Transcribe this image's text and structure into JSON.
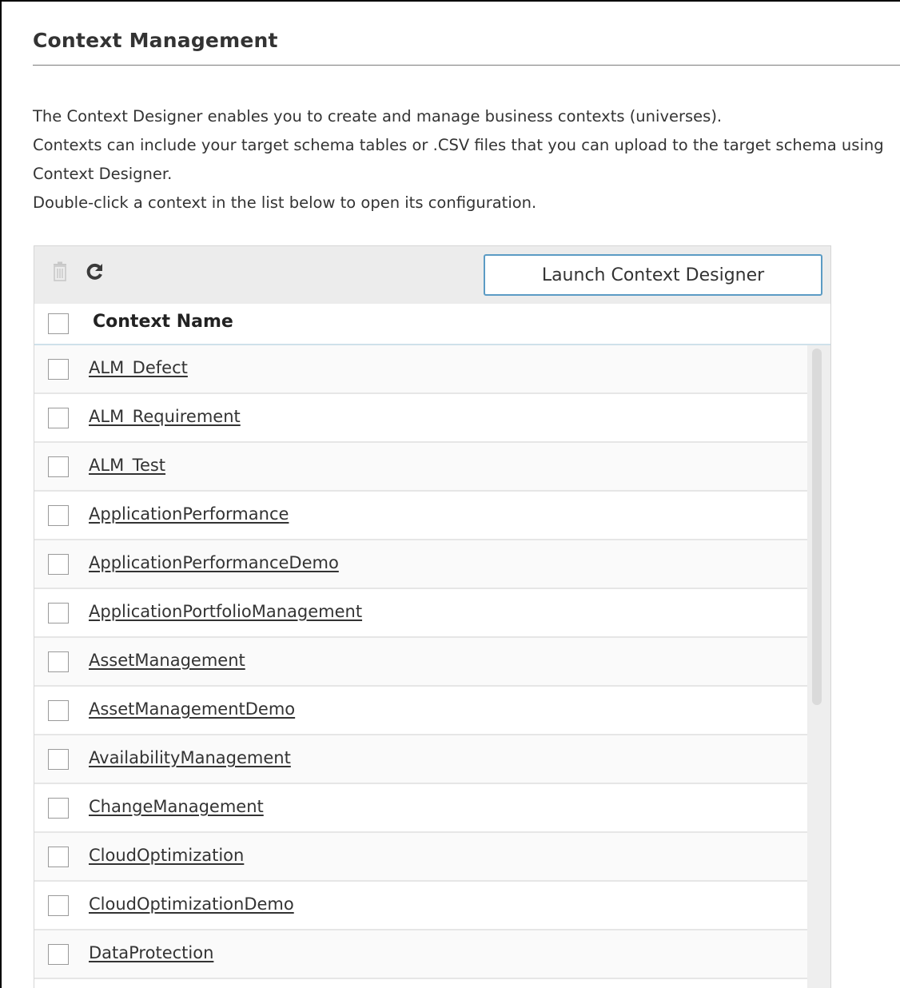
{
  "page": {
    "title": "Context Management",
    "intro_lines": [
      "The Context Designer enables you to create and manage business contexts (universes).",
      "Contexts can include your target schema tables or .CSV files that you can upload to the target schema using Context Designer.",
      "Double-click a context in the list below to open its configuration."
    ]
  },
  "toolbar": {
    "delete_icon": "trash-icon",
    "refresh_icon": "refresh-icon",
    "launch_button_label": "Launch Context Designer"
  },
  "table": {
    "column_header": "Context Name",
    "rows": [
      "ALM_Defect",
      "ALM_Requirement",
      "ALM_Test",
      "ApplicationPerformance",
      "ApplicationPerformanceDemo",
      "ApplicationPortfolioManagement",
      "AssetManagement",
      "AssetManagementDemo",
      "AvailabilityManagement",
      "ChangeManagement",
      "CloudOptimization",
      "CloudOptimizationDemo",
      "DataProtection"
    ]
  },
  "colors": {
    "button_border": "#5b9bc4",
    "toolbar_bg": "#ececec",
    "header_underline": "#cfe1ea"
  }
}
